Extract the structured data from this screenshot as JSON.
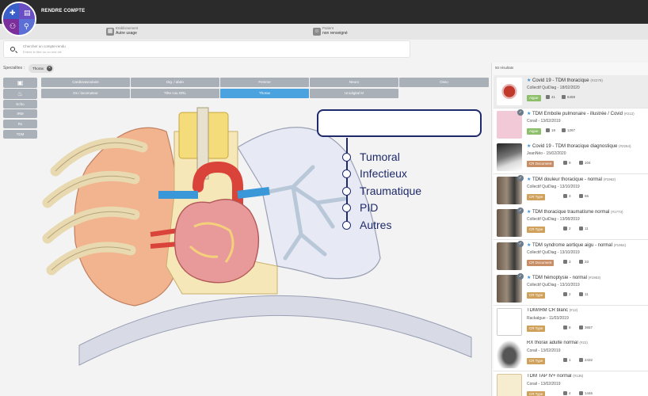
{
  "app": {
    "title": "RENDRE COMPTE"
  },
  "context": {
    "etablissement": {
      "label": "Etablissement",
      "value": "Autre usage"
    },
    "patient": {
      "label": "Patient",
      "value": "non renseigné"
    }
  },
  "search": {
    "placeholder": "Chercher un compte-rendu",
    "hint": "Entrez le titre ou un mot clé"
  },
  "filters": {
    "label": "Specialites :",
    "chip": "Thorax"
  },
  "modalities": [
    "Echo",
    "IRM",
    "Rx",
    "TDM"
  ],
  "categories": [
    [
      "Cardiovasculaire",
      "Dig. / abdo",
      "Femme",
      "Neuro",
      "Osso"
    ],
    [
      "Os / locomoteur",
      "Tête cou ORL",
      "Thorax",
      "Urodigital M"
    ]
  ],
  "options": [
    "Tumoral",
    "Infectieux",
    "Traumatique",
    "PID",
    "Autres"
  ],
  "results": {
    "count": "50 résultats",
    "items": [
      {
        "title": "Covid 19 - TDM thoracique",
        "id": "(#2279)",
        "author": "Collectif QuiDiag - 18/02/2020",
        "tag": "Aigue",
        "likes": "41",
        "views": "5458",
        "thumb": "virus",
        "starred": true,
        "tagColor": "green",
        "checked": false
      },
      {
        "title": "TDM Embolie pulmonaire - illustrée / Covid",
        "id": "(#212)",
        "author": "Corail - 13/02/2019",
        "tag": "Aigue",
        "likes": "18",
        "views": "1267",
        "thumb": "pink",
        "starred": true,
        "tagColor": "green",
        "checked": true
      },
      {
        "title": "Covid 19 - TDM thoracique diagnostique",
        "id": "(#2264)",
        "author": "JeanNéo - 15/02/2020",
        "tag": "CR Document",
        "likes": "9",
        "views": "104",
        "thumb": "xray",
        "starred": true,
        "tagColor": "brown",
        "checked": false
      },
      {
        "title": "TDM douleur thoracique - normal",
        "id": "(#1962)",
        "author": "Collectif QuiDiag - 13/10/2019",
        "tag": "CR Type",
        "likes": "3",
        "views": "66",
        "thumb": "video",
        "starred": true,
        "tagColor": "",
        "checked": true
      },
      {
        "title": "TDM thoracique traumatisme normal",
        "id": "(#1773)",
        "author": "Collectif QuiDiag - 13/08/2019",
        "tag": "CR Type",
        "likes": "2",
        "views": "11",
        "thumb": "video",
        "starred": true,
        "tagColor": "",
        "checked": true
      },
      {
        "title": "TDM syndrome aortique aigu - normal",
        "id": "(#1964)",
        "author": "Collectif QuiDiag - 13/10/2019",
        "tag": "CR Document",
        "likes": "3",
        "views": "33",
        "thumb": "video",
        "starred": true,
        "tagColor": "brown",
        "checked": true
      },
      {
        "title": "TDM hémoptysie - normal",
        "id": "(#1963)",
        "author": "Collectif QuiDiag - 13/10/2019",
        "tag": "CR Type",
        "likes": "2",
        "views": "11",
        "thumb": "video",
        "starred": true,
        "tagColor": "",
        "checked": true
      },
      {
        "title": "TDM/IRM CR blanc",
        "id": "(#12)",
        "author": "Rackalgue - 11/03/2019",
        "tag": "CR Type",
        "likes": "8",
        "views": "3657",
        "thumb": "doc",
        "starred": false,
        "tagColor": "",
        "checked": false
      },
      {
        "title": "RX thorax adulte normal",
        "id": "(#22)",
        "author": "Corail - 13/02/2019",
        "tag": "CR Type",
        "likes": "1",
        "views": "2432",
        "thumb": "chest",
        "starred": false,
        "tagColor": "",
        "checked": false
      },
      {
        "title": "TDM TAP IV+ normal",
        "id": "(#135)",
        "author": "Corail - 13/02/2019",
        "tag": "CR Type",
        "likes": "4",
        "views": "1446",
        "thumb": "scroll",
        "starred": false,
        "tagColor": "",
        "checked": false
      }
    ]
  }
}
